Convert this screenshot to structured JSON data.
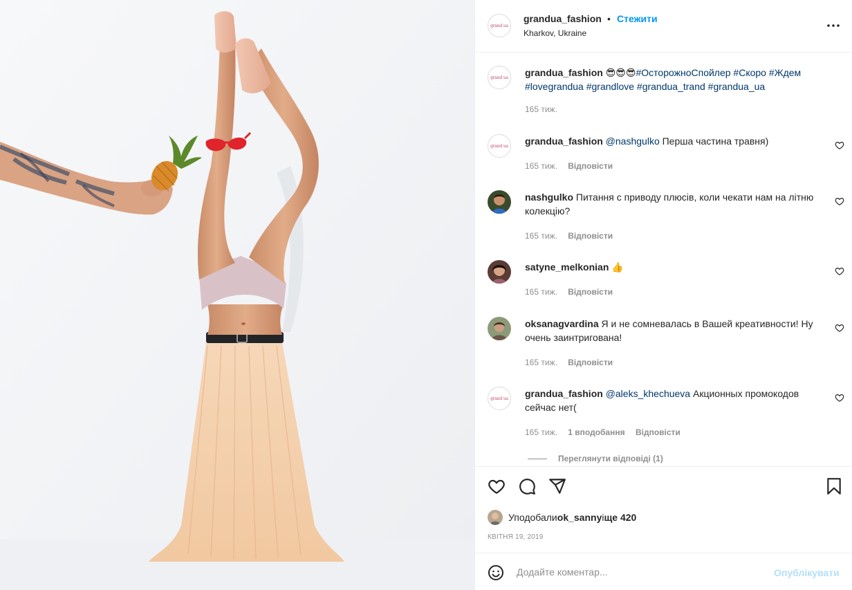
{
  "post": {
    "username": "grandua_fashion",
    "separator": "•",
    "follow_label": "Стежити",
    "location": "Kharkov, Ukraine",
    "brand_avatar_text": "grand ua"
  },
  "caption": {
    "username": "grandua_fashion",
    "emojis": "😎😎😎",
    "text": "#ОсторожноСпойлер #Скоро #Ждем #lovegrandua #grandlove #grandua_trand #grandua_ua",
    "time": "165 тиж."
  },
  "comments": [
    {
      "username": "grandua_fashion",
      "mention": "@nashgulko",
      "text": " Перша частина травня)",
      "time": "165 тиж.",
      "likes": "",
      "reply_label": "Відповісти"
    },
    {
      "username": "nashgulko",
      "mention": "",
      "text": " Питання с приводу плюсів, коли чекати нам на літню колекцію?",
      "time": "165 тиж.",
      "likes": "",
      "reply_label": "Відповісти"
    },
    {
      "username": "satyne_melkonian",
      "mention": "",
      "text": " 👍",
      "time": "165 тиж.",
      "likes": "",
      "reply_label": "Відповісти"
    },
    {
      "username": "oksanagvardina",
      "mention": "",
      "text": " Я и не сомневалась в Вашей креативности!  Ну очень заинтригована!",
      "time": "165 тиж.",
      "likes": "",
      "reply_label": "Відповісти"
    },
    {
      "username": "grandua_fashion",
      "mention": "@aleks_khechueva",
      "text": " Акционных промокодов сейчас нет(",
      "time": "165 тиж.",
      "likes": "1 вподобання",
      "reply_label": "Відповісти"
    }
  ],
  "view_replies": "Переглянути відповіді (1)",
  "likes": {
    "prefix": "Уподобали ",
    "user": "ok_sanny",
    "middle": " і ",
    "count": "ще 420"
  },
  "date": "КВІТНЯ 19, 2019",
  "add_comment": {
    "placeholder": "Додайте коментар...",
    "publish_label": "Опублікувати"
  },
  "icons": {
    "more": "more-icon",
    "heart": "heart-icon",
    "comment": "comment-icon",
    "share": "share-icon",
    "save": "bookmark-icon",
    "emoji": "emoji-icon"
  },
  "colors": {
    "link_blue": "#0095f6",
    "hashtag": "#00376b",
    "muted": "#8e8e8e",
    "publish_disabled": "#b2dffc"
  }
}
